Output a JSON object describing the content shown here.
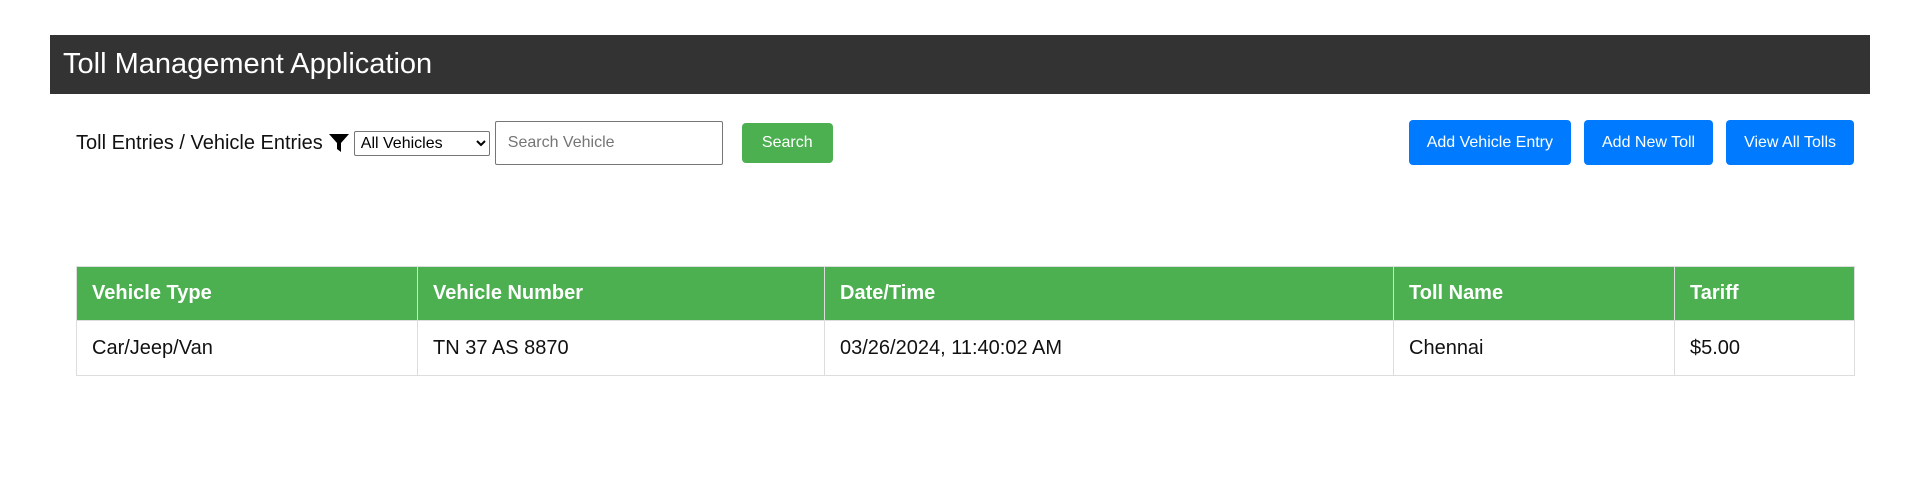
{
  "app": {
    "title": "Toll Management Application"
  },
  "toolbar": {
    "breadcrumb": "Toll Entries / Vehicle Entries",
    "filter_icon": "filter-icon",
    "filter_selected": "All Vehicles",
    "search_placeholder": "Search Vehicle",
    "search_label": "Search"
  },
  "actions": {
    "add_vehicle_entry": "Add Vehicle Entry",
    "add_new_toll": "Add New Toll",
    "view_all_tolls": "View All Tolls"
  },
  "table": {
    "headers": [
      "Vehicle Type",
      "Vehicle Number",
      "Date/Time",
      "Toll Name",
      "Tariff"
    ],
    "rows": [
      [
        "Car/Jeep/Van",
        "TN 37 AS 8870",
        "03/26/2024, 11:40:02 AM",
        "Chennai",
        "$5.00"
      ]
    ]
  },
  "colors": {
    "header_bg": "#333333",
    "accent_green": "#4caf50",
    "primary_blue": "#007bff"
  }
}
